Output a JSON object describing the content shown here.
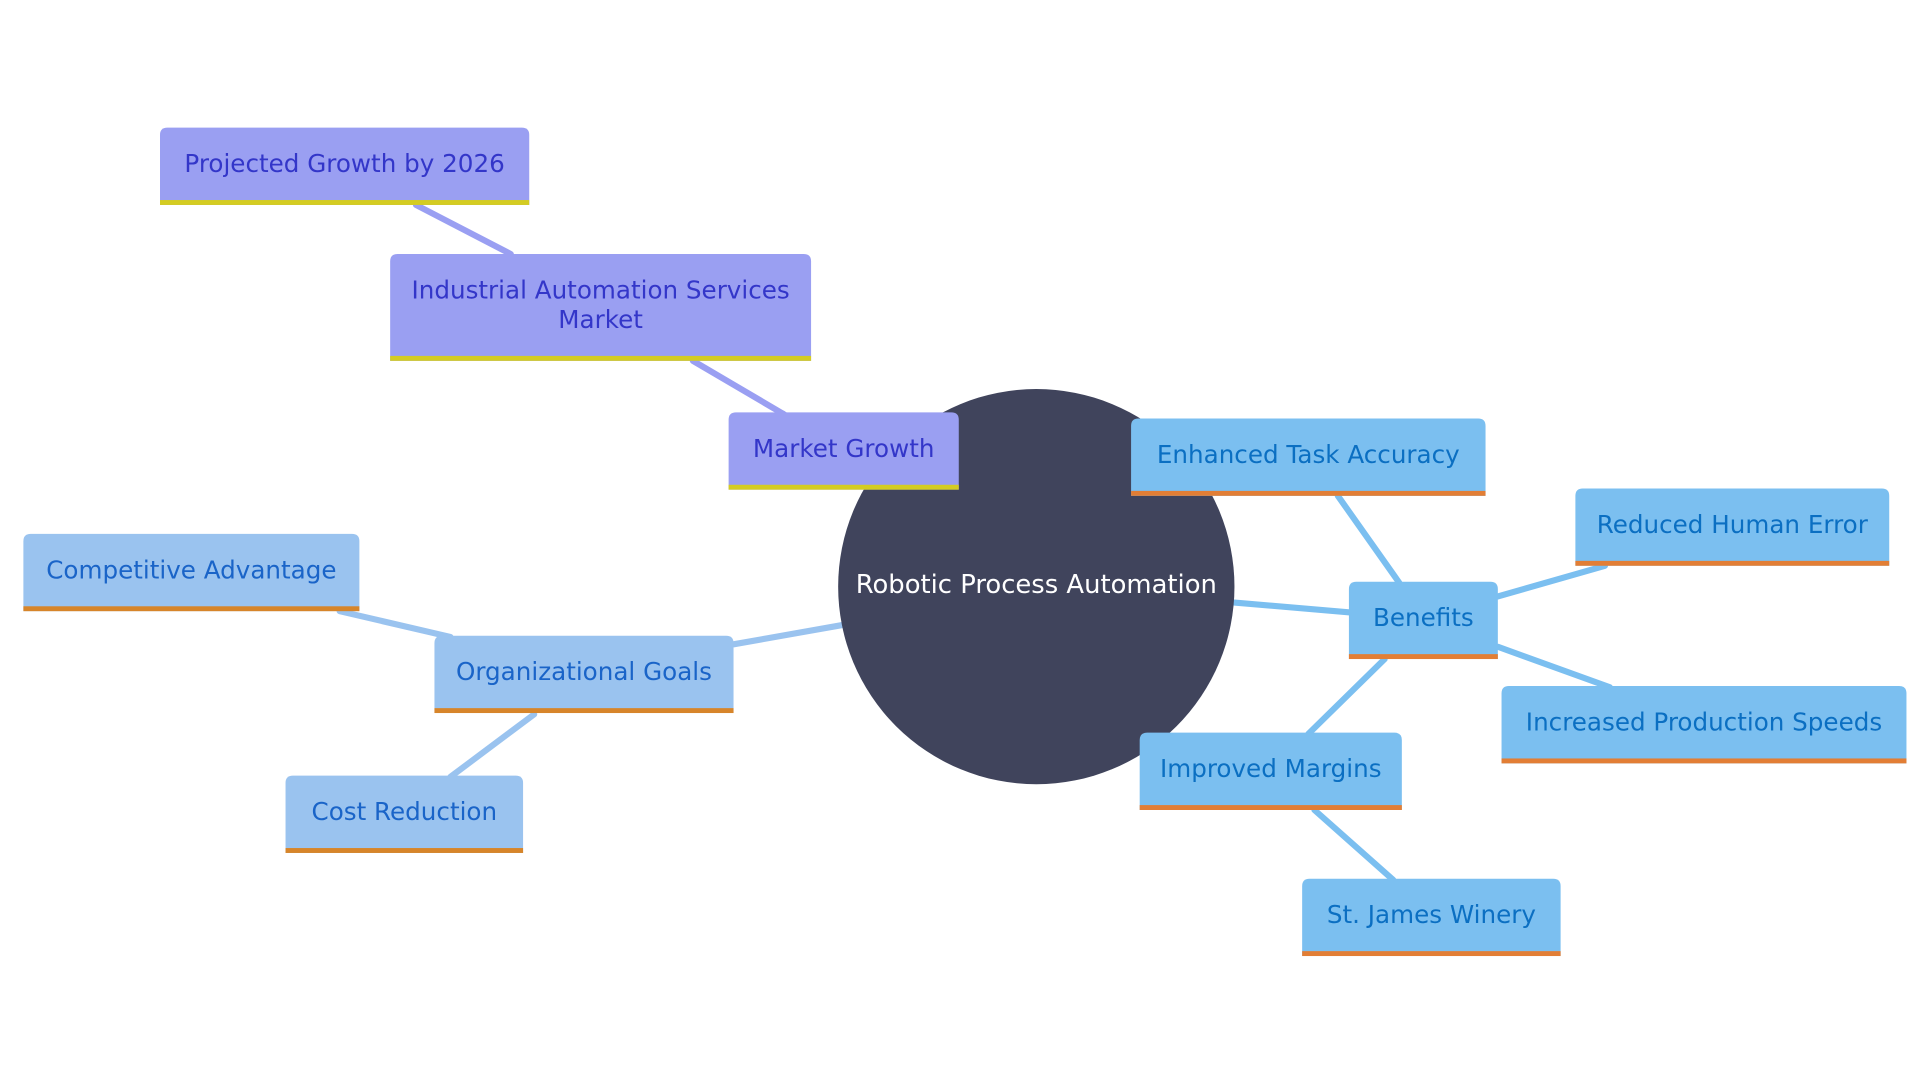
{
  "diagram": {
    "type": "mindmap",
    "root": {
      "id": "root",
      "label": "Robotic Process Automation",
      "color": "#40445c",
      "text_color": "#ffffff"
    },
    "themes": {
      "purple": {
        "fill": "#9a9ff2",
        "border": "#d4cc22",
        "text": "#3336c9",
        "edge": "#9a9ff2"
      },
      "lightblue": {
        "fill": "#9ac3ef",
        "border": "#d7852a",
        "text": "#1a64c8",
        "edge": "#9ac3ef"
      },
      "blue": {
        "fill": "#7bbff0",
        "border": "#e27e35",
        "text": "#0b6fc2",
        "edge": "#7bbff0"
      }
    },
    "nodes": [
      {
        "id": "market-growth",
        "label": "Market Growth",
        "parent": "root",
        "theme": "purple"
      },
      {
        "id": "industrial-automation",
        "label": "Industrial Automation Services Market",
        "parent": "market-growth",
        "theme": "purple"
      },
      {
        "id": "projected-growth",
        "label": "Projected Growth by 2026",
        "parent": "industrial-automation",
        "theme": "purple"
      },
      {
        "id": "organizational-goals",
        "label": "Organizational Goals",
        "parent": "root",
        "theme": "lightblue"
      },
      {
        "id": "competitive-advantage",
        "label": "Competitive Advantage",
        "parent": "organizational-goals",
        "theme": "lightblue"
      },
      {
        "id": "cost-reduction",
        "label": "Cost Reduction",
        "parent": "organizational-goals",
        "theme": "lightblue"
      },
      {
        "id": "benefits",
        "label": "Benefits",
        "parent": "root",
        "theme": "blue"
      },
      {
        "id": "enhanced-task-accuracy",
        "label": "Enhanced Task Accuracy",
        "parent": "benefits",
        "theme": "blue"
      },
      {
        "id": "reduced-human-error",
        "label": "Reduced Human Error",
        "parent": "benefits",
        "theme": "blue"
      },
      {
        "id": "increased-production-speeds",
        "label": "Increased Production Speeds",
        "parent": "benefits",
        "theme": "blue"
      },
      {
        "id": "improved-margins",
        "label": "Improved Margins",
        "parent": "benefits",
        "theme": "blue"
      },
      {
        "id": "st-james-winery",
        "label": "St. James Winery",
        "parent": "improved-margins",
        "theme": "blue"
      }
    ]
  }
}
